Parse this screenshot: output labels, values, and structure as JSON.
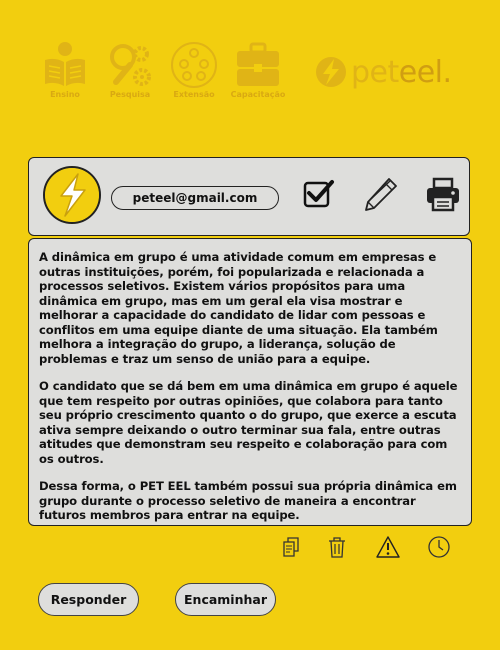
{
  "nav": {
    "items": [
      {
        "label": "Ensino",
        "icon": "book-reader-icon"
      },
      {
        "label": "Pesquisa",
        "icon": "research-gears-icon"
      },
      {
        "label": "Extensão",
        "icon": "community-icon"
      },
      {
        "label": "Capacitação",
        "icon": "briefcase-icon"
      }
    ],
    "logo_prefix": "pet",
    "logo_suffix": "eel."
  },
  "profile": {
    "email": "peteel@gmail.com",
    "avatar_icon": "lightning-avatar-icon"
  },
  "toolbar": {
    "icons": [
      "checkbox-icon",
      "pencil-icon",
      "printer-icon"
    ]
  },
  "message": {
    "paragraphs": [
      "A dinâmica em grupo é uma atividade comum em empresas e outras instituições, porém, foi popularizada e relacionada a processos seletivos. Existem vários propósitos para uma dinâmica em grupo, mas em um geral ela visa mostrar e melhorar a capacidade do candidato de lidar com pessoas e conflitos em uma equipe diante de uma situação. Ela também melhora a integração do grupo, a liderança, solução de problemas e traz um senso de união para a equipe.",
      "O candidato que se dá bem em uma dinâmica em grupo é aquele que tem respeito por outras opiniões, que colabora para tanto seu próprio crescimento quanto o do grupo, que exerce a escuta ativa sempre deixando o outro terminar sua fala, entre outras atitudes que demonstram seu respeito e colaboração para com os outros.",
      "Dessa forma, o PET EEL também possui sua própria dinâmica em grupo durante o processo seletivo de maneira a encontrar futuros membros para entrar na equipe."
    ]
  },
  "actions": {
    "icons": [
      "copy-icon",
      "trash-icon",
      "warning-icon",
      "clock-icon"
    ]
  },
  "buttons": {
    "reply": "Responder",
    "forward": "Encaminhar"
  },
  "colors": {
    "background": "#F2CE0F",
    "panel": "#DEDEDC",
    "nav_icon": "#E0B416",
    "nav_label": "#D9A912"
  }
}
